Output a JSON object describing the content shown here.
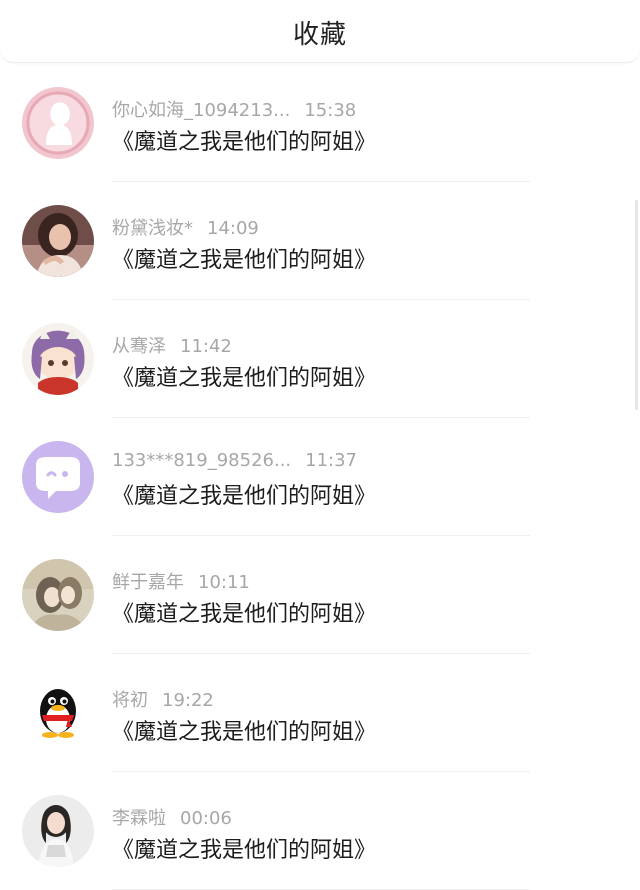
{
  "header": {
    "title": "收藏"
  },
  "items": [
    {
      "name": "你心如海_1094213...",
      "time": "15:38",
      "text": "《魔道之我是他们的阿姐》",
      "avatar_icon": "pink-silhouette-avatar"
    },
    {
      "name": "粉黛浅妆*",
      "time": "14:09",
      "text": "《魔道之我是他们的阿姐》",
      "avatar_icon": "woman-photo-avatar"
    },
    {
      "name": "从骞泽",
      "time": "11:42",
      "text": "《魔道之我是他们的阿姐》",
      "avatar_icon": "anime-character-avatar"
    },
    {
      "name": "133***819_98526...",
      "time": "11:37",
      "text": "《魔道之我是他们的阿姐》",
      "avatar_icon": "chat-bubble-avatar"
    },
    {
      "name": "鲜于嘉年",
      "time": "10:11",
      "text": "《魔道之我是他们的阿姐》",
      "avatar_icon": "illustration-couple-avatar"
    },
    {
      "name": "将初",
      "time": "19:22",
      "text": "《魔道之我是他们的阿姐》",
      "avatar_icon": "qq-penguin-avatar"
    },
    {
      "name": "李霖啦",
      "time": "00:06",
      "text": "《魔道之我是他们的阿姐》",
      "avatar_icon": "girl-photo-avatar"
    }
  ],
  "colors": {
    "meta_text": "#a7a7a7",
    "message_text": "#1d1d1d",
    "accent_purple": "#c9b6ee"
  }
}
